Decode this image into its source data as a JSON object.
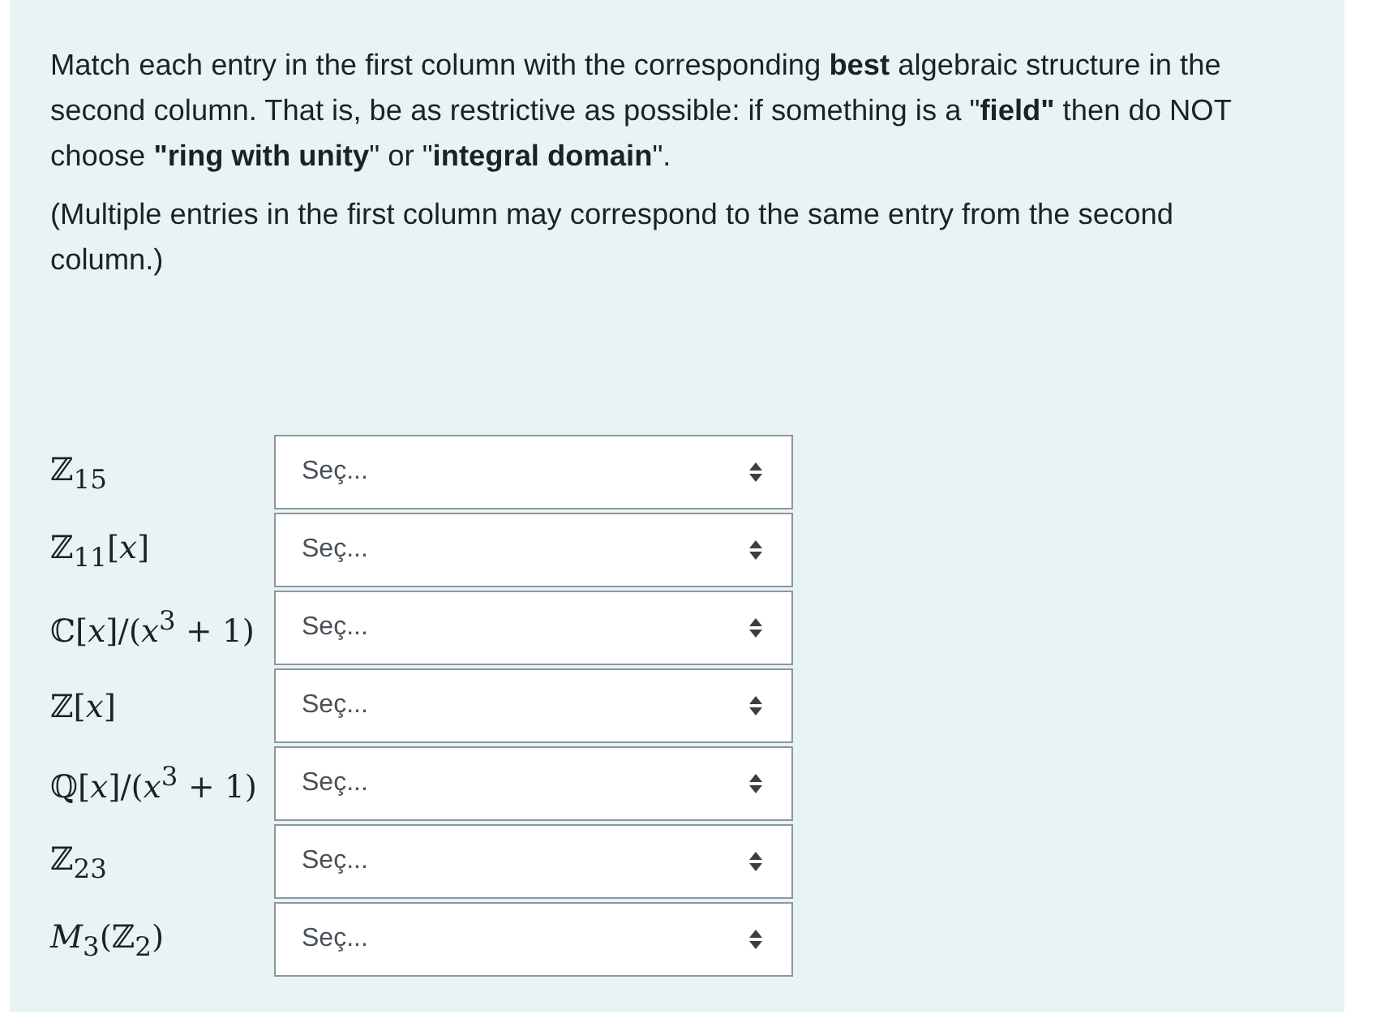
{
  "instructions": [
    "Match each entry in the first column with the corresponding **best** algebraic structure in the second column. That is, be as restrictive as possible: if something is a \"**field\"** then do NOT choose **\"ring with unity**\" or \"**integral domain**\".",
    "(Multiple entries in the first column may correspond to the same entry from the second column.)"
  ],
  "matches": [
    {
      "item": "ℤ$_{15}$",
      "choice": "Seç..."
    },
    {
      "item": "ℤ$_{11}$[*x*]",
      "choice": "Seç..."
    },
    {
      "item": "ℂ[*x*]/(*x*$^{3}$ + 1)",
      "choice": "Seç..."
    },
    {
      "item": "ℤ[*x*]",
      "choice": "Seç..."
    },
    {
      "item": "ℚ[*x*]/(*x*$^{3}$ + 1)",
      "choice": "Seç..."
    },
    {
      "item": "ℤ$_{23}$",
      "choice": "Seç..."
    },
    {
      "item": "*M*$_{3}$(ℤ$_{2}$)",
      "choice": "Seç..."
    }
  ]
}
